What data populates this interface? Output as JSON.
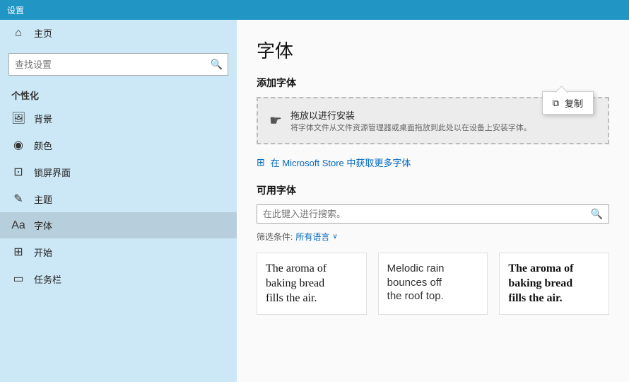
{
  "titlebar": {
    "label": "设置"
  },
  "sidebar": {
    "search_placeholder": "查找设置",
    "section_label": "个性化",
    "items": [
      {
        "id": "home",
        "icon": "⌂",
        "label": "主页"
      },
      {
        "id": "background",
        "icon": "🖼",
        "label": "背景"
      },
      {
        "id": "color",
        "icon": "◉",
        "label": "颜色"
      },
      {
        "id": "lockscreen",
        "icon": "⊡",
        "label": "锁屏界面"
      },
      {
        "id": "theme",
        "icon": "✎",
        "label": "主题"
      },
      {
        "id": "font",
        "icon": "Aa",
        "label": "字体"
      },
      {
        "id": "start",
        "icon": "⊞",
        "label": "开始"
      },
      {
        "id": "taskbar",
        "icon": "▭",
        "label": "任务栏"
      }
    ]
  },
  "content": {
    "page_title": "字体",
    "add_section_title": "添加字体",
    "drop_zone": {
      "icon": "☛",
      "primary": "拖放以进行安装",
      "secondary": "将字体文件从文件资源管理器或桌面拖放到此处以在设备上安装字体。"
    },
    "tooltip": {
      "icon": "⧉",
      "label": "复制"
    },
    "store_link": "在 Microsoft Store 中获取更多字体",
    "available_section_title": "可用字体",
    "font_search_placeholder": "在此键入进行搜索。",
    "filter": {
      "label": "筛选条件:",
      "value": "所有语言",
      "chevron": "∨"
    },
    "font_cards": [
      {
        "style": "normal",
        "lines": [
          "The aroma of",
          "baking bread",
          "fills the air."
        ]
      },
      {
        "style": "light",
        "lines": [
          "Melodic rain",
          "bounces off",
          "the roof top."
        ]
      },
      {
        "style": "bold",
        "lines": [
          "The aroma of",
          "baking bread",
          "fills the air."
        ]
      }
    ]
  }
}
